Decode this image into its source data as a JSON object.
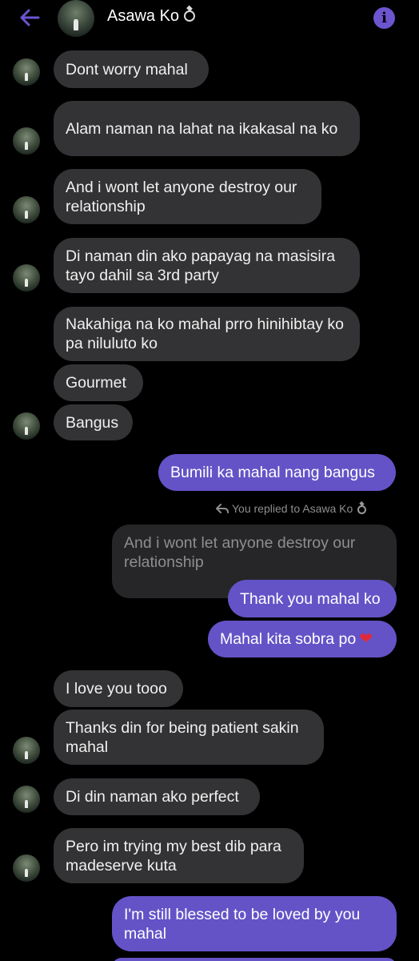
{
  "header": {
    "contact_name": "Asawa Ko",
    "icons": {
      "back": "back-arrow-icon",
      "ring": "ring-icon",
      "info": "info-icon"
    },
    "accent_color": "#6453c7"
  },
  "messages": [
    {
      "from": "them",
      "text": "Dont worry mahal"
    },
    {
      "from": "them",
      "text": "Alam naman na lahat na ikakasal na ko"
    },
    {
      "from": "them",
      "text": "And i wont let anyone destroy our relationship"
    },
    {
      "from": "them",
      "text": "Di naman din ako papayag na masisira tayo dahil sa 3rd party"
    },
    {
      "from": "them",
      "text": "Nakahiga na ko mahal prro hinihibtay ko pa niluluto ko"
    },
    {
      "from": "them",
      "text": "Gourmet"
    },
    {
      "from": "them",
      "text": "Bangus"
    },
    {
      "from": "me",
      "text": "Bumili ka mahal nang bangus"
    },
    {
      "from": "meta",
      "text": "You replied to Asawa Ko"
    },
    {
      "from": "quote",
      "text": "And i wont let anyone destroy our relationship"
    },
    {
      "from": "me",
      "text": "Thank you mahal ko"
    },
    {
      "from": "me",
      "text": "Mahal kita sobra po"
    },
    {
      "from": "them",
      "text": "I love you tooo"
    },
    {
      "from": "them",
      "text": "Thanks din for being patient sakin mahal"
    },
    {
      "from": "them",
      "text": "Di din naman ako perfect"
    },
    {
      "from": "them",
      "text": "Pero im trying my best dib para madeserve kuta"
    },
    {
      "from": "me",
      "text": "I'm still blessed to be loved by you mahal"
    }
  ]
}
